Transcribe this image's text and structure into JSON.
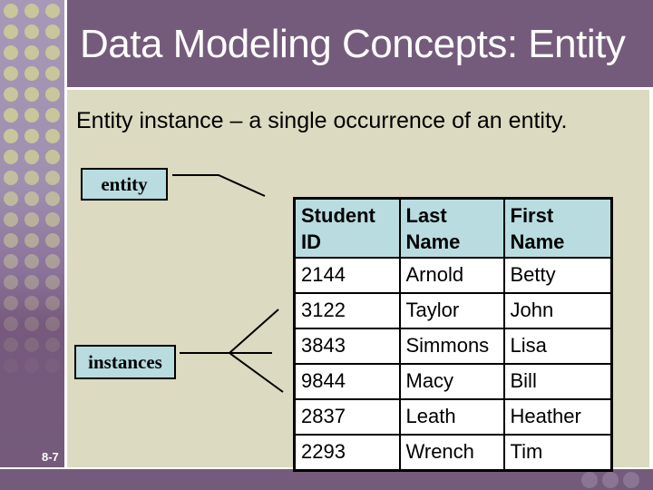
{
  "slide": {
    "title": "Data Modeling Concepts: Entity",
    "subtitle": "Entity instance – a single occurrence of an entity.",
    "page_number": "8-7"
  },
  "diagram": {
    "entity_label": "entity",
    "instances_label": "instances"
  },
  "table": {
    "headers": [
      "Student ID",
      "Last Name",
      "First Name"
    ],
    "rows": [
      [
        "2144",
        "Arnold",
        "Betty"
      ],
      [
        "3122",
        "Taylor",
        "John"
      ],
      [
        "3843",
        "Simmons",
        "Lisa"
      ],
      [
        "9844",
        "Macy",
        "Bill"
      ],
      [
        "2837",
        "Leath",
        "Heather"
      ],
      [
        "2293",
        "Wrench",
        "Tim"
      ]
    ]
  },
  "colors": {
    "theme_purple": "#745b7b",
    "sidebar_lavender": "#a898b8",
    "dot_color": "#c8c69a",
    "content_beige": "#dcdac0",
    "label_fill": "#b8dce0"
  }
}
